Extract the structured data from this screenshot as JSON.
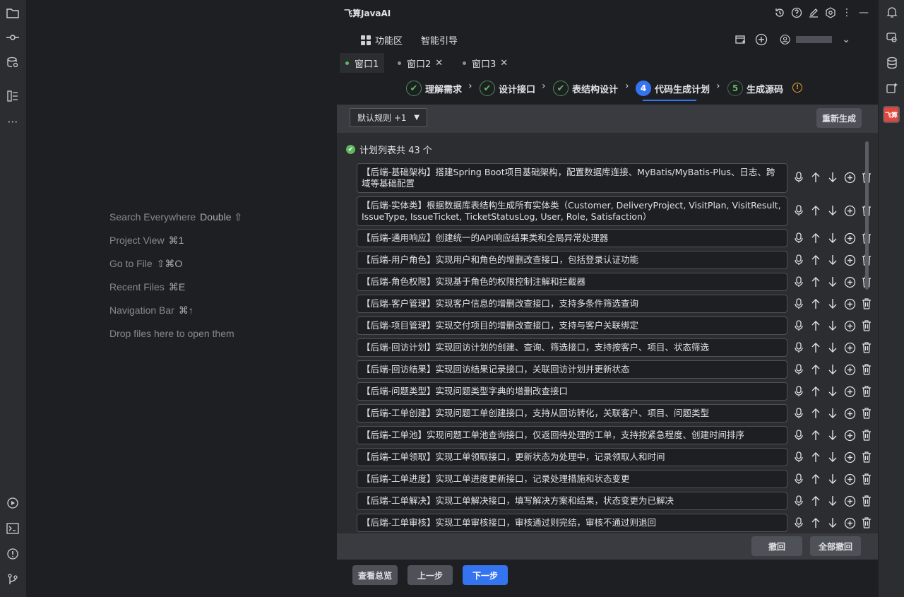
{
  "editor_hints": [
    {
      "label": "Search Everywhere",
      "key": "Double ⇧"
    },
    {
      "label": "Project View",
      "key": "⌘1"
    },
    {
      "label": "Go to File",
      "key": "⇧⌘O"
    },
    {
      "label": "Recent Files",
      "key": "⌘E"
    },
    {
      "label": "Navigation Bar",
      "key": "⌘↑"
    },
    {
      "label": "Drop files here to open them",
      "key": ""
    }
  ],
  "plugin": {
    "title": "飞算JavaAI",
    "menu": {
      "workspace": "功能区",
      "guide": "智能引导"
    },
    "tabs": [
      {
        "label": "窗口1"
      },
      {
        "label": "窗口2"
      },
      {
        "label": "窗口3"
      }
    ],
    "steps": [
      {
        "num": "✔",
        "label": "理解需求"
      },
      {
        "num": "✔",
        "label": "设计接口"
      },
      {
        "num": "✔",
        "label": "表结构设计"
      },
      {
        "num": "4",
        "label": "代码生成计划"
      },
      {
        "num": "5",
        "label": "生成源码"
      }
    ],
    "rule_select": "默认规则 +1",
    "regenerate": "重新生成",
    "count_text": "计划列表共 43 个",
    "items": [
      "【后端-基础架构】搭建Spring Boot项目基础架构，配置数据库连接、MyBatis/MyBatis-Plus、日志、跨域等基础配置",
      "【后端-实体类】根据数据库表结构生成所有实体类（Customer, DeliveryProject, VisitPlan, VisitResult, IssueType, IssueTicket, TicketStatusLog, User, Role, Satisfaction）",
      "【后端-通用响应】创建统一的API响应结果类和全局异常处理器",
      "【后端-用户角色】实现用户和角色的增删改查接口，包括登录认证功能",
      "【后端-角色权限】实现基于角色的权限控制注解和拦截器",
      "【后端-客户管理】实现客户信息的增删改查接口，支持多条件筛选查询",
      "【后端-项目管理】实现交付项目的增删改查接口，支持与客户关联绑定",
      "【后端-回访计划】实现回访计划的创建、查询、筛选接口，支持按客户、项目、状态筛选",
      "【后端-回访结果】实现回访结果记录接口，关联回访计划并更新状态",
      "【后端-问题类型】实现问题类型字典的增删改查接口",
      "【后端-工单创建】实现问题工单创建接口，支持从回访转化，关联客户、项目、问题类型",
      "【后端-工单池】实现问题工单池查询接口，仅返回待处理的工单，支持按紧急程度、创建时间排序",
      "【后端-工单领取】实现工单领取接口，更新状态为处理中，记录领取人和时间",
      "【后端-工单进度】实现工单进度更新接口，记录处理措施和状态变更",
      "【后端-工单解决】实现工单解决接口，填写解决方案和结果，状态变更为已解决",
      "【后端-工单审核】实现工单审核接口，审核通过则完结，审核不通过则退回"
    ],
    "undo": "撤回",
    "undo_all": "全部撤回",
    "overview": "查看总览",
    "prev": "上一步",
    "next": "下一步",
    "logo_text": "飞算"
  }
}
